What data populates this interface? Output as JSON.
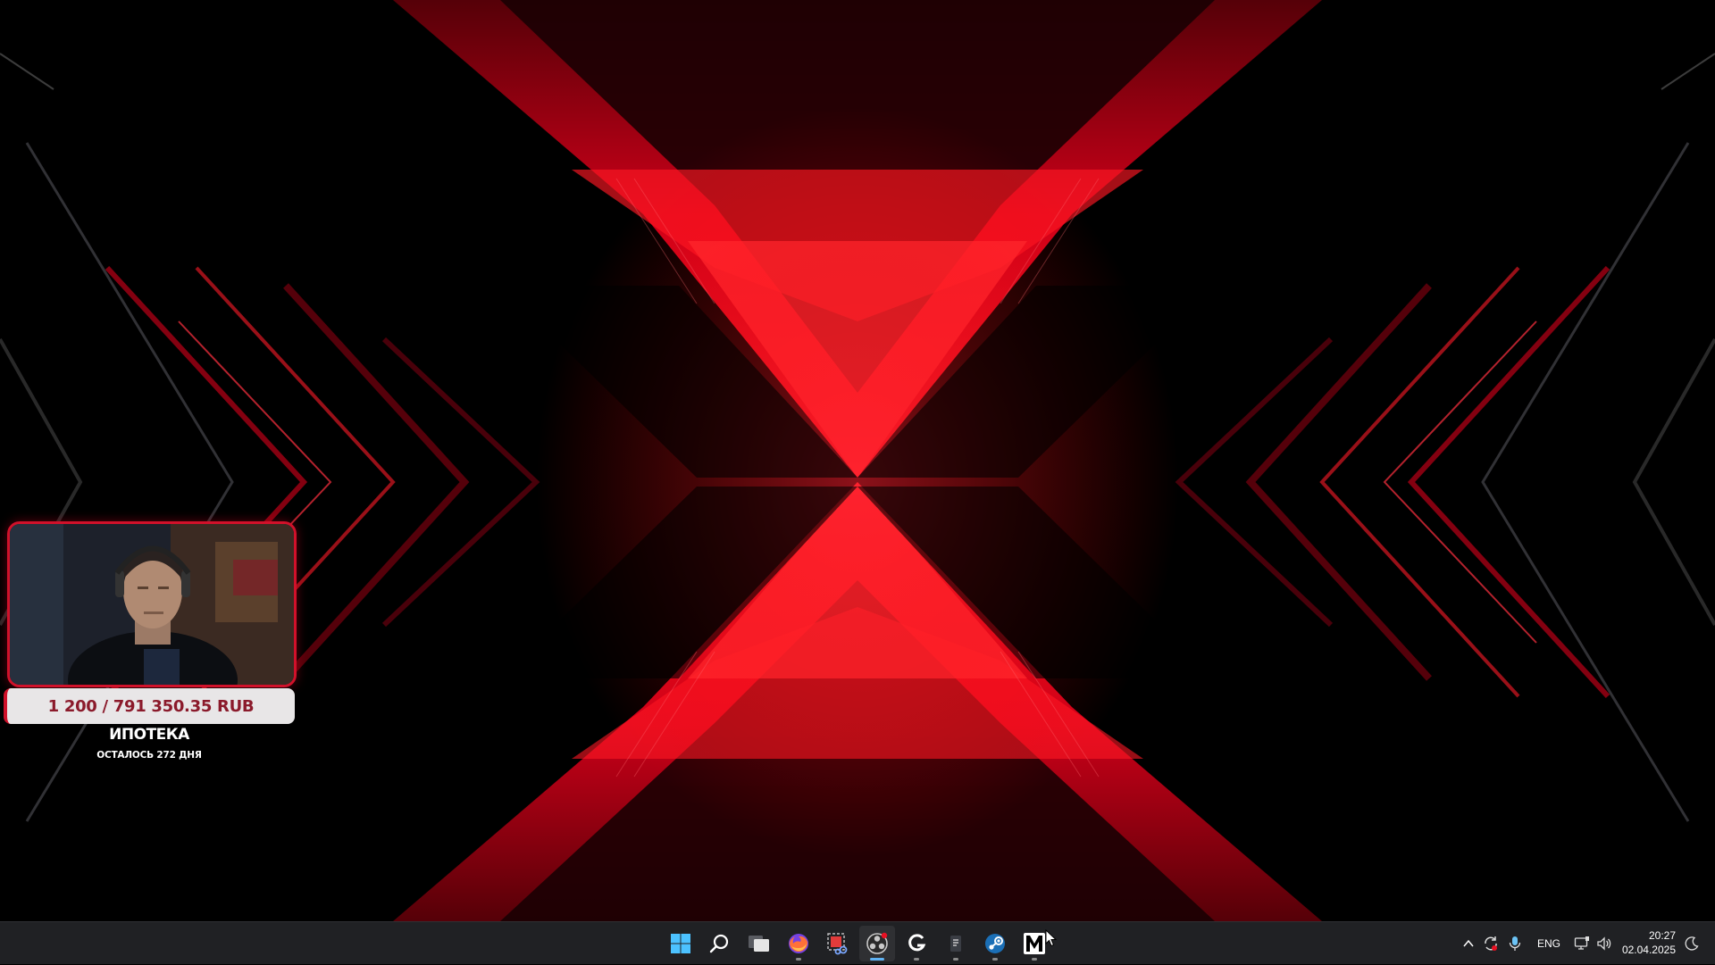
{
  "desktop": {
    "wallpaper": "red-x-abstract-wallpaper",
    "colors": {
      "accent_red": "#ff1020",
      "deep_red": "#8a0010",
      "background": "#000000"
    }
  },
  "overlay": {
    "webcam_icon": "webcam-feed",
    "goal": {
      "amount": "1 200 / 791 350.35 RUB",
      "title": "ИПОТЕКА",
      "remaining": "ОСТАЛОСЬ 272 ДНЯ",
      "colors": {
        "border": "#d1112a",
        "bar_bg": "#e8e6e7",
        "text": "#8b1a2b"
      }
    }
  },
  "taskbar": {
    "apps": [
      {
        "name": "start",
        "icon": "windows-start-icon",
        "running": false
      },
      {
        "name": "search",
        "icon": "search-icon",
        "running": false
      },
      {
        "name": "task-view",
        "icon": "task-view-icon",
        "running": false
      },
      {
        "name": "firefox",
        "icon": "firefox-icon",
        "running": true
      },
      {
        "name": "snipping-tool",
        "icon": "snipping-tool-icon",
        "running": false
      },
      {
        "name": "obs",
        "icon": "obs-icon",
        "running": true,
        "active": true
      },
      {
        "name": "logitech-g-hub",
        "icon": "logitech-g-icon",
        "running": true
      },
      {
        "name": "notepad",
        "icon": "notepad-icon",
        "running": true
      },
      {
        "name": "steam",
        "icon": "steam-icon",
        "running": true
      },
      {
        "name": "m-app",
        "icon": "m-letter-icon",
        "running": true
      }
    ],
    "tray": {
      "language": "ENG",
      "time": "20:27",
      "date": "02.04.2025"
    }
  }
}
